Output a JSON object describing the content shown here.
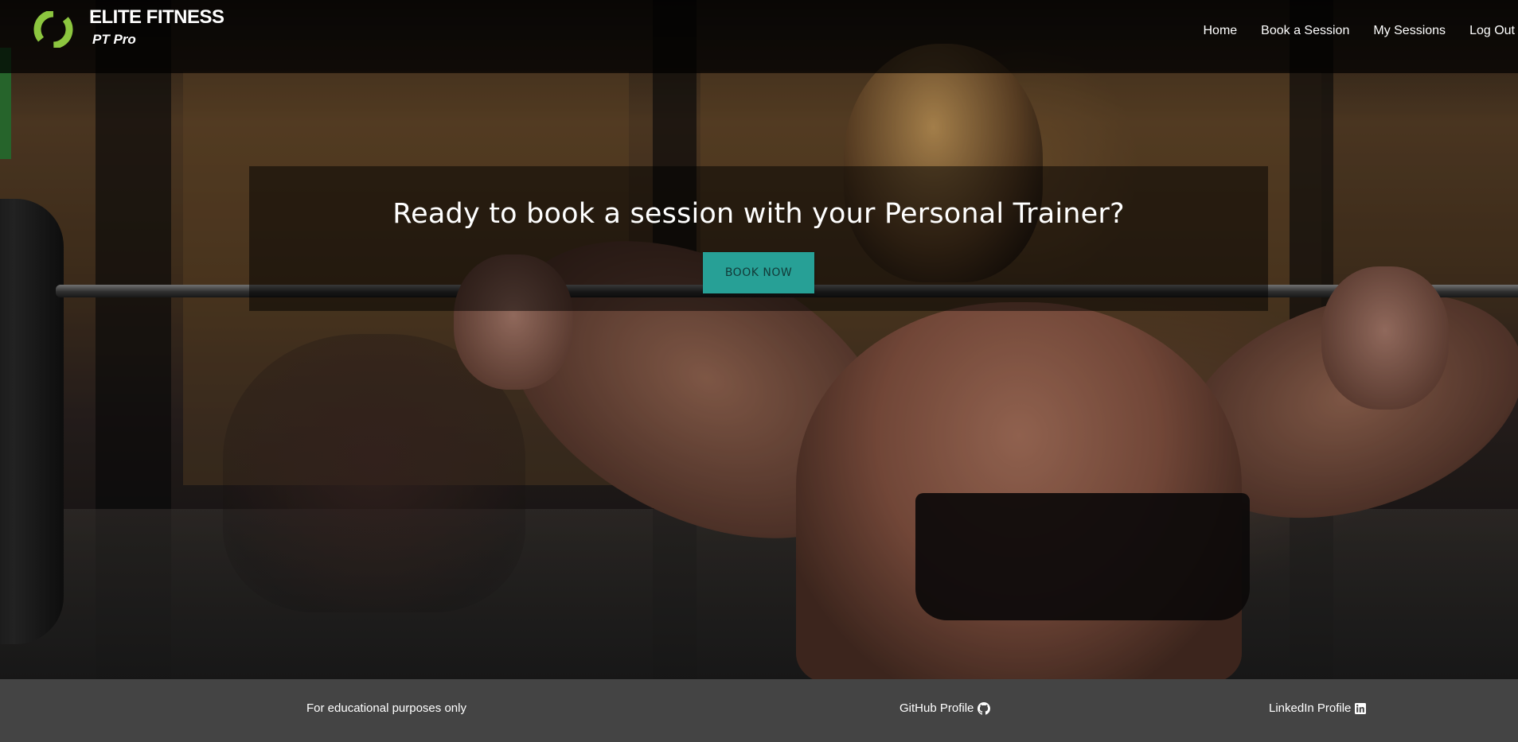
{
  "navbar": {
    "brand_title": "ELITE FITNESS",
    "brand_subtitle": "PT Pro",
    "logo_color": "#8cc63f",
    "links": [
      {
        "label": "Home"
      },
      {
        "label": "Book a Session"
      },
      {
        "label": "My Sessions"
      },
      {
        "label": "Log Out"
      }
    ]
  },
  "hero": {
    "heading": "Ready to book a session with your Personal Trainer?",
    "button_label": "BOOK NOW",
    "button_color": "#27a096"
  },
  "footer": {
    "note": "For educational purposes only",
    "github_label": "GitHub Profile",
    "github_icon": "github-icon",
    "linkedin_label": "LinkedIn Profile",
    "linkedin_icon": "linkedin-icon",
    "background": "#444444"
  }
}
